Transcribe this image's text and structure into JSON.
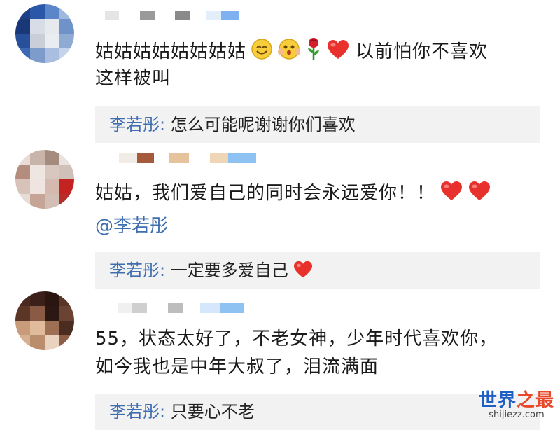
{
  "comments": [
    {
      "text_line1": "姑姑姑姑姑姑姑姑",
      "emojis": [
        "grin-emoji",
        "shy-emoji",
        "rose-emoji",
        "heart-emoji"
      ],
      "text_line1_tail": "以前怕你不喜欢",
      "text_line2": "这样被叫",
      "reply": {
        "name": "李若彤",
        "colon": ":",
        "text": "怎么可能呢谢谢你们喜欢"
      }
    },
    {
      "text_line1": "姑姑，我们爱自己的同时会永远爱你！！",
      "emojis": [
        "heart-emoji",
        "heart-emoji"
      ],
      "mention": "@李若彤",
      "reply": {
        "name": "李若彤",
        "colon": ":",
        "text": "一定要多爱自己"
      }
    },
    {
      "text_line1": "55，状态太好了，不老女神，少年时代喜欢你，",
      "text_line2": "如今我也是中年大叔了，泪流满面",
      "reply": {
        "name": "李若彤",
        "colon": ":",
        "text": "只要心不老"
      }
    }
  ],
  "watermark": {
    "main_a": "世界",
    "main_b": "之最",
    "sub": "shijiezz.com"
  },
  "colors": {
    "link": "#3e6db0",
    "reply_bg": "#f2f2f2",
    "heart": "#e8312c"
  }
}
